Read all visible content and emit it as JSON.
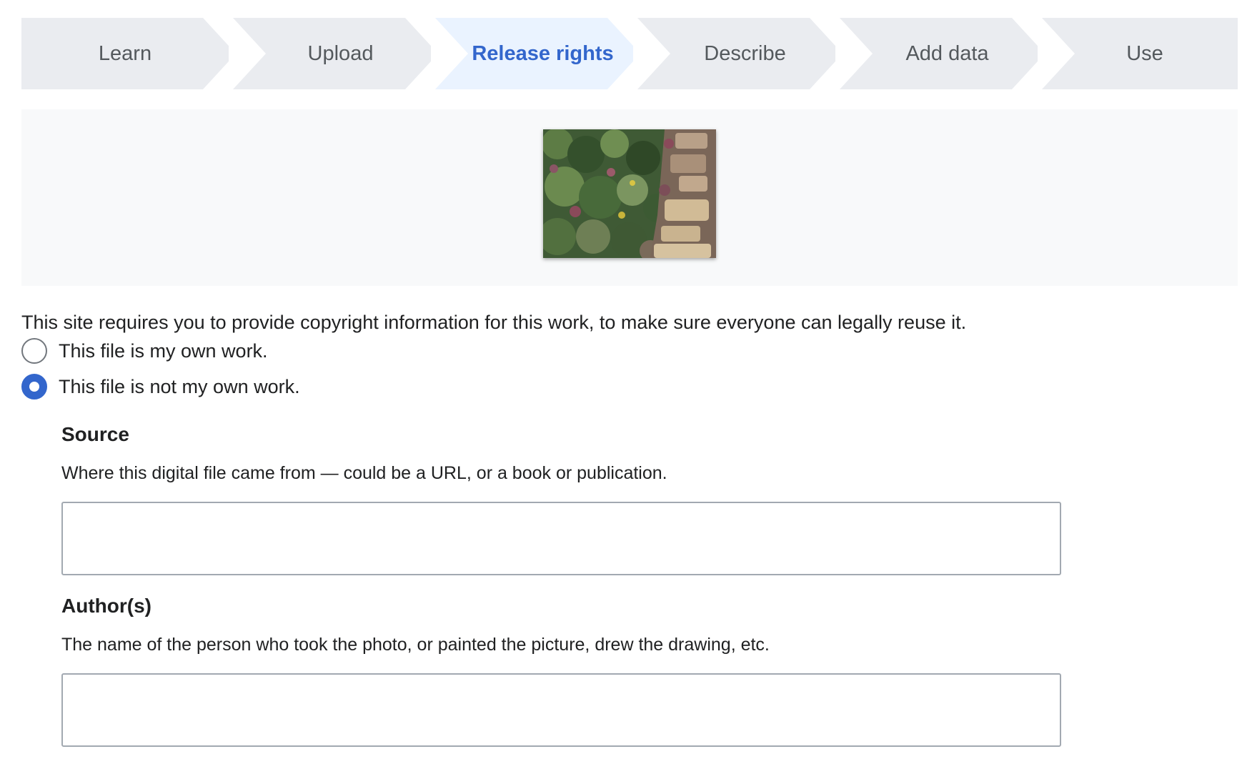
{
  "steps": [
    {
      "label": "Learn",
      "state": "default"
    },
    {
      "label": "Upload",
      "state": "default"
    },
    {
      "label": "Release rights",
      "state": "active"
    },
    {
      "label": "Describe",
      "state": "default"
    },
    {
      "label": "Add data",
      "state": "default"
    },
    {
      "label": "Use",
      "state": "default"
    }
  ],
  "colors": {
    "step_default_bg": "#eaecf0",
    "step_active_bg": "#eaf3ff",
    "active_text": "#3366cc",
    "preview_bg": "#f8f9fa",
    "radio_checked": "#3366cc"
  },
  "preview": {
    "thumbnail_icon": "garden-photo-thumbnail"
  },
  "copyright": {
    "intro": "This site requires you to provide copyright information for this work, to make sure everyone can legally reuse it.",
    "options": [
      {
        "label": "This file is my own work.",
        "checked": false
      },
      {
        "label": "This file is not my own work.",
        "checked": true
      }
    ]
  },
  "source": {
    "label": "Source",
    "help": "Where this digital file came from — could be a URL, or a book or publication.",
    "value": ""
  },
  "author": {
    "label": "Author(s)",
    "help": "The name of the person who took the photo, or painted the picture, drew the drawing, etc.",
    "value": ""
  }
}
